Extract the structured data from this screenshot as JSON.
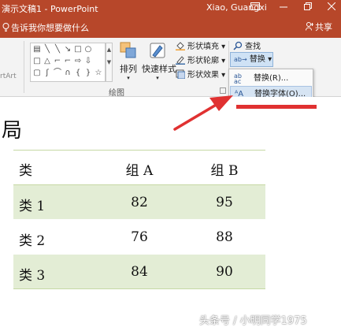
{
  "titlebar": {
    "title": "演示文稿1  -  PowerPoint",
    "user": "Xiao, Guangxi",
    "ribbon_display_icon": "ribbon-display-icon",
    "minimize_icon": "minimize-icon",
    "restore_icon": "restore-icon",
    "close_icon": "close-icon"
  },
  "tellbar": {
    "tell_me": "告诉我你想要做什么",
    "share": "共享"
  },
  "ribbon": {
    "smartart_partial": "rtArt",
    "arrange_label": "排列",
    "quick_styles_label": "快速样式",
    "shape_fill_label": "形状填充",
    "shape_outline_label": "形状轮廓",
    "shape_effects_label": "形状效果",
    "find_label": "查找",
    "replace_label": "替换",
    "drawing_group_label": "绘图"
  },
  "replace_menu": {
    "items": [
      {
        "label": "替换(R)...",
        "icon": "replace-icon"
      },
      {
        "label": "替换字体(O)...",
        "icon": "replace-font-icon",
        "highlighted": true
      }
    ]
  },
  "slide": {
    "title": "局",
    "table": {
      "headers": [
        "类",
        "组 A",
        "组 B"
      ],
      "rows": [
        [
          "类 1",
          "82",
          "95"
        ],
        [
          "类 2",
          "76",
          "88"
        ],
        [
          "类 3",
          "84",
          "90"
        ]
      ]
    }
  },
  "annotation": {
    "arrow_color": "#e03131",
    "accent_color": "#b7472a",
    "table_band_color": "#e3edd5"
  },
  "watermark": "头条号 / 小明同学1975"
}
